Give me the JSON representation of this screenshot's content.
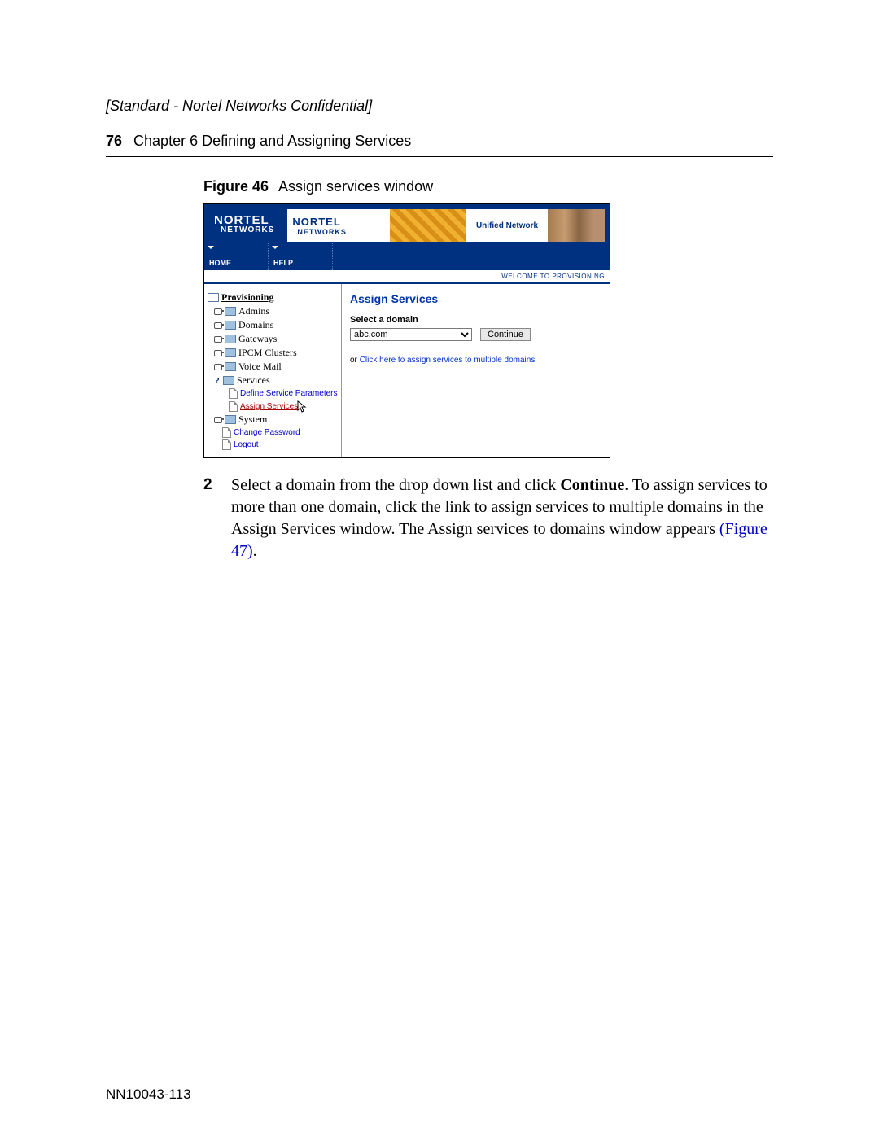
{
  "header": {
    "confidential": "[Standard - Nortel Networks Confidential]",
    "page_num": "76",
    "chapter": "Chapter 6  Defining and Assigning Services"
  },
  "figure": {
    "label": "Figure 46",
    "caption": "Assign services window"
  },
  "app": {
    "logo_line1": "NORTEL",
    "logo_line2": "NETWORKS",
    "banner_tag": "Unified Network",
    "menu": {
      "home": "HOME",
      "help": "HELP"
    },
    "welcome": "WELCOME TO PROVISIONING",
    "tree": {
      "root": "Provisioning",
      "admins": "Admins",
      "domains": "Domains",
      "gateways": "Gateways",
      "ipcm": "IPCM Clusters",
      "voicemail": "Voice Mail",
      "services": "Services",
      "define_params": "Define Service Parameters",
      "assign_services": "Assign Services",
      "system": "System",
      "change_pw": "Change Password",
      "logout": "Logout"
    },
    "content": {
      "title": "Assign Services",
      "select_label": "Select a domain",
      "domain_value": "abc.com",
      "continue": "Continue",
      "or": "or",
      "multi_link": "Click here to assign services to multiple domains"
    }
  },
  "step": {
    "num": "2",
    "t1": "Select a domain from the drop down list and click ",
    "bold": "Continue",
    "t2": ". To assign services to more than one domain, click the link to assign services to multiple domains in the Assign Services window. The Assign services to domains window appears ",
    "xref": "(Figure 47)",
    "t3": "."
  },
  "footer": {
    "doc_id": "NN10043-113"
  }
}
